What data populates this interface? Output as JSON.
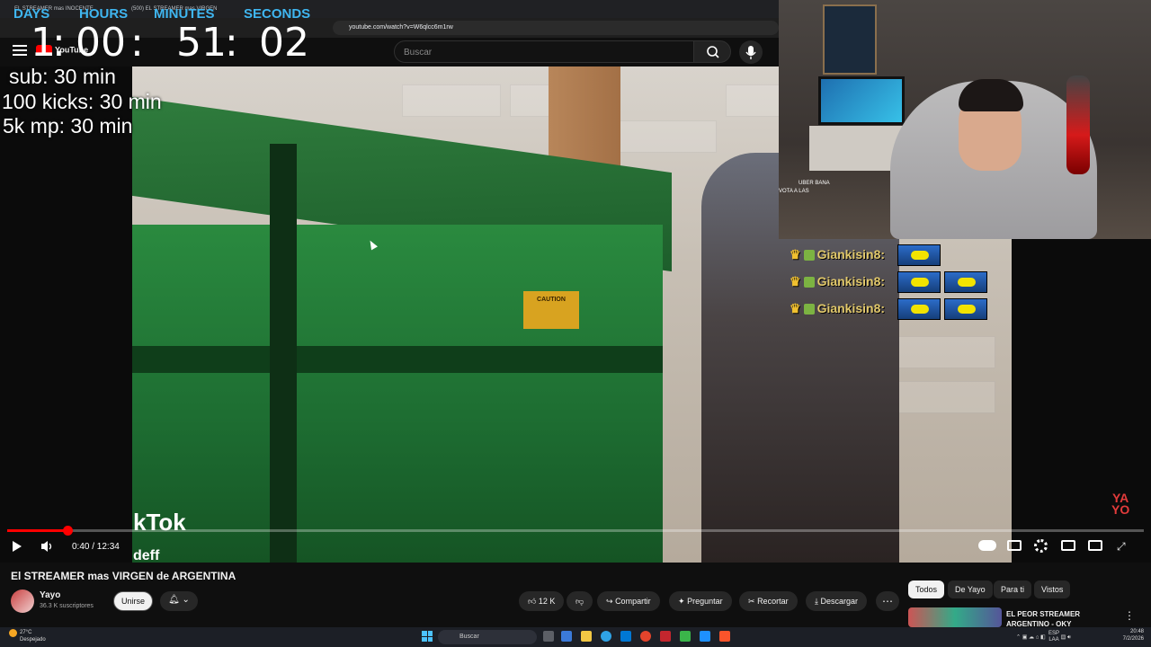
{
  "browser": {
    "tab1": "EL STREAMER mas INOCENTE",
    "tab2": "(500) EL STREAMER mas VIRGEN",
    "url": "youtube.com/watch?v=W6qlcc6m1rw"
  },
  "youtube_header": {
    "logo": "YouTube",
    "search_placeholder": "Buscar"
  },
  "countdown": {
    "labels": {
      "days": "DAYS",
      "hours": "HOURS",
      "minutes": "MINUTES",
      "seconds": "SECONDS"
    },
    "days": "1",
    "hours": "00",
    "minutes": "51",
    "seconds": "02",
    "sep": ":"
  },
  "goals": [
    "sub: 30 min",
    "100 kicks: 30 min",
    "5k mp: 30 min"
  ],
  "webcam_chat": {
    "line1": "UBER BANA",
    "line2": "VOTA A LAS"
  },
  "chat": [
    {
      "user": "Giankisin8:"
    },
    {
      "user": "Giankisin8:"
    },
    {
      "user": "Giankisin8:"
    }
  ],
  "video_overlay": {
    "caution": "CAUTION",
    "tiktok": "kTok",
    "tiktok_sub": "deff",
    "watermark_top": "YA",
    "watermark_bottom": "YO"
  },
  "player": {
    "time": "0:40 / 12:34",
    "progress": 0.053
  },
  "video_info": {
    "title": "El STREAMER mas VIRGEN de ARGENTINA",
    "channel": "Yayo",
    "subscribers": "36.3 K suscriptores",
    "join": "Unirse",
    "likes": "12 K",
    "share": "Compartir",
    "ask": "Preguntar",
    "clip": "Recortar",
    "download": "Descargar"
  },
  "filter_chips": [
    "Todos",
    "De Yayo",
    "Para ti",
    "Vistos"
  ],
  "recommendation": {
    "title": "EL PEOR STREAMER ARGENTINO - OKY"
  },
  "taskbar": {
    "temp": "27°C",
    "weather": "Despejado",
    "search": "Buscar",
    "lang1": "ESP",
    "lang2": "LAA",
    "time": "20:48",
    "date": "7/2/2026"
  }
}
